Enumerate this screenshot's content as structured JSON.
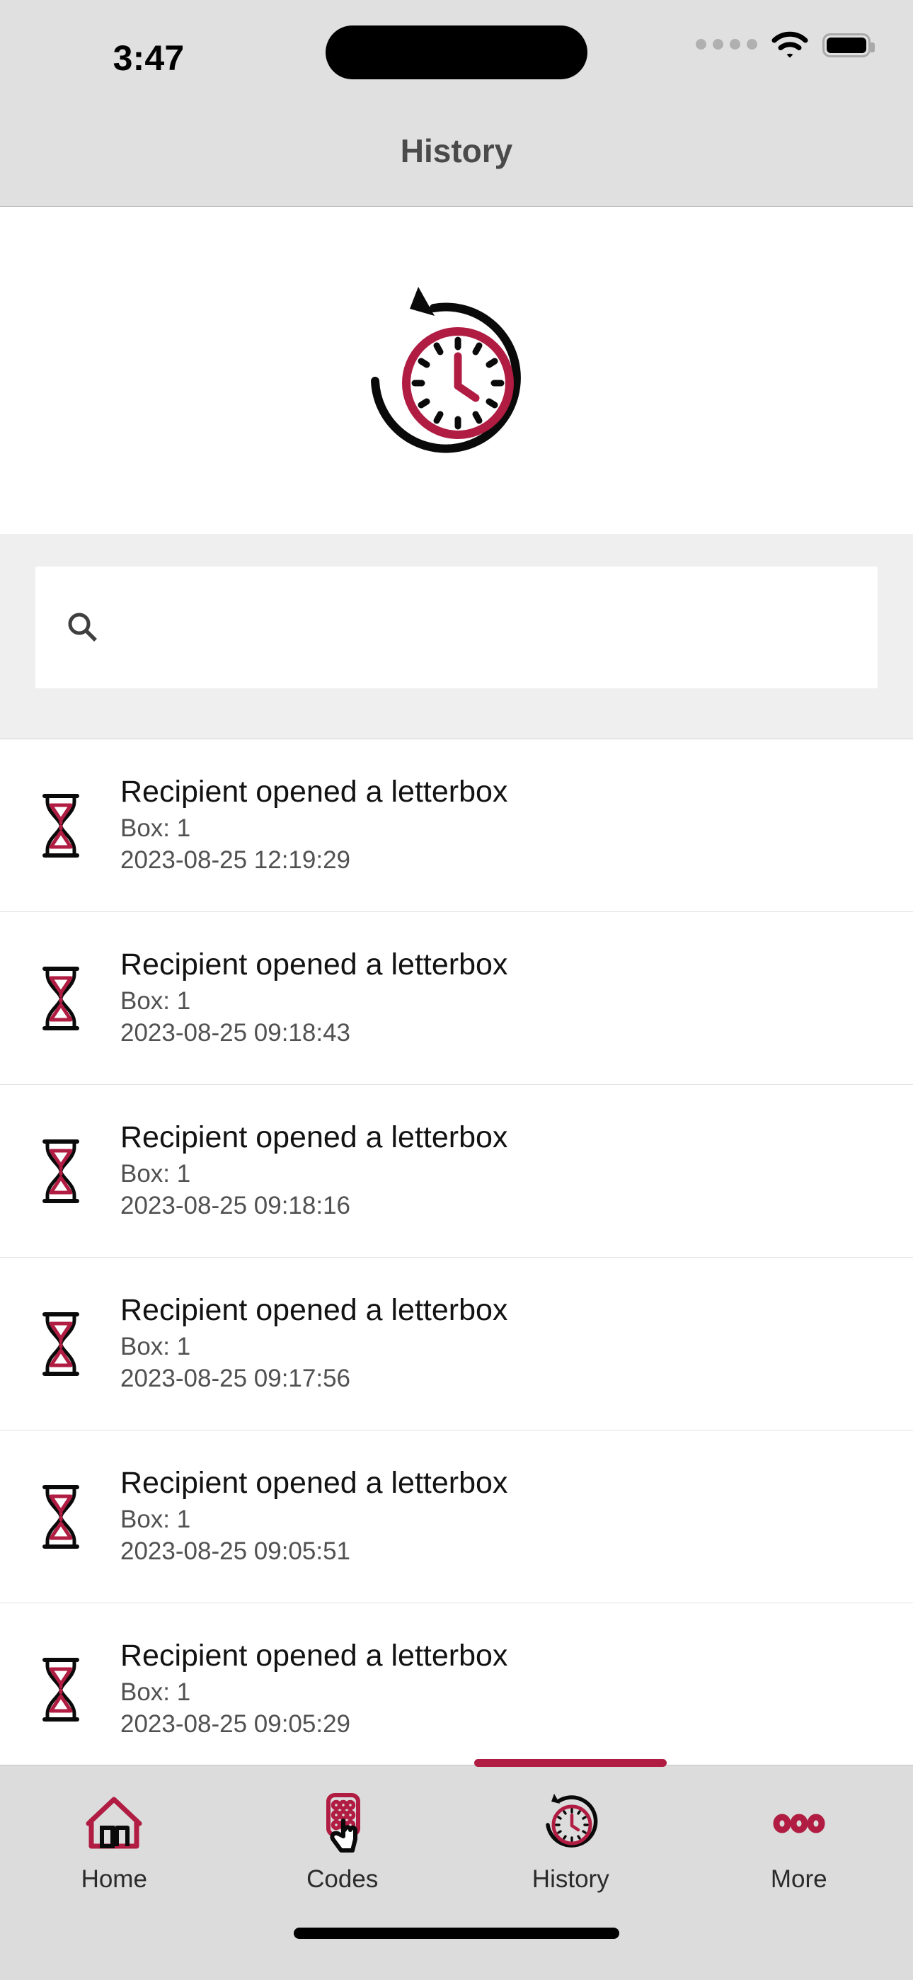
{
  "status_bar": {
    "time": "3:47",
    "signal_icon": "cellular-dots-icon",
    "wifi_icon": "wifi-icon",
    "battery_icon": "battery-full-icon"
  },
  "header": {
    "title": "History"
  },
  "hero": {
    "icon": "history-clock-icon"
  },
  "search": {
    "icon": "search-icon",
    "value": "",
    "placeholder": ""
  },
  "colors": {
    "accent": "#b01c42",
    "header_bg": "#e0e0e0",
    "search_band_bg": "#efefef",
    "tabbar_bg": "#dcdcdc",
    "title_text": "#4a4a4a",
    "row_title_text": "#121212",
    "row_sub_text": "#515151"
  },
  "list": {
    "items": [
      {
        "icon": "hourglass-icon",
        "title": "Recipient opened a letterbox",
        "box": "Box: 1",
        "timestamp": "2023-08-25 12:19:29"
      },
      {
        "icon": "hourglass-icon",
        "title": "Recipient opened a letterbox",
        "box": "Box: 1",
        "timestamp": "2023-08-25 09:18:43"
      },
      {
        "icon": "hourglass-icon",
        "title": "Recipient opened a letterbox",
        "box": "Box: 1",
        "timestamp": "2023-08-25 09:18:16"
      },
      {
        "icon": "hourglass-icon",
        "title": "Recipient opened a letterbox",
        "box": "Box: 1",
        "timestamp": "2023-08-25 09:17:56"
      },
      {
        "icon": "hourglass-icon",
        "title": "Recipient opened a letterbox",
        "box": "Box: 1",
        "timestamp": "2023-08-25 09:05:51"
      },
      {
        "icon": "hourglass-icon",
        "title": "Recipient opened a letterbox",
        "box": "Box: 1",
        "timestamp": "2023-08-25 09:05:29"
      }
    ]
  },
  "tabbar": {
    "active": "History",
    "items": [
      {
        "label": "Home",
        "icon": "home-icon"
      },
      {
        "label": "Codes",
        "icon": "keypad-hand-icon"
      },
      {
        "label": "History",
        "icon": "history-clock-icon"
      },
      {
        "label": "More",
        "icon": "ellipsis-icon"
      }
    ]
  }
}
